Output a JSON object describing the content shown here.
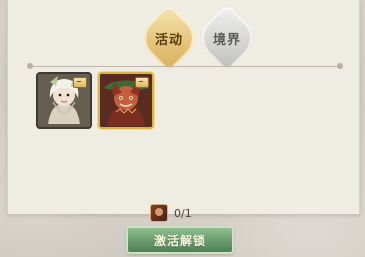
{
  "tabs": [
    {
      "label": "活动",
      "state": "selected"
    },
    {
      "label": "境界",
      "state": "default"
    }
  ],
  "items": [
    {
      "icon": "female-character-portrait-icon",
      "badge_icon": "gold-tag-icon"
    },
    {
      "icon": "red-monster-portrait-icon",
      "badge_icon": "gold-tag-icon",
      "selected": true
    }
  ],
  "unlock": {
    "progress_text": "0/1",
    "button_label": "激活解锁",
    "token_icon": "portrait-token-icon"
  },
  "colors": {
    "panel_background": "#efece4",
    "active_tab": "#e6c57a",
    "inactive_tab": "#d6d6d3",
    "button_green": "#6f9f71",
    "selected_frame": "#d8b24f"
  }
}
